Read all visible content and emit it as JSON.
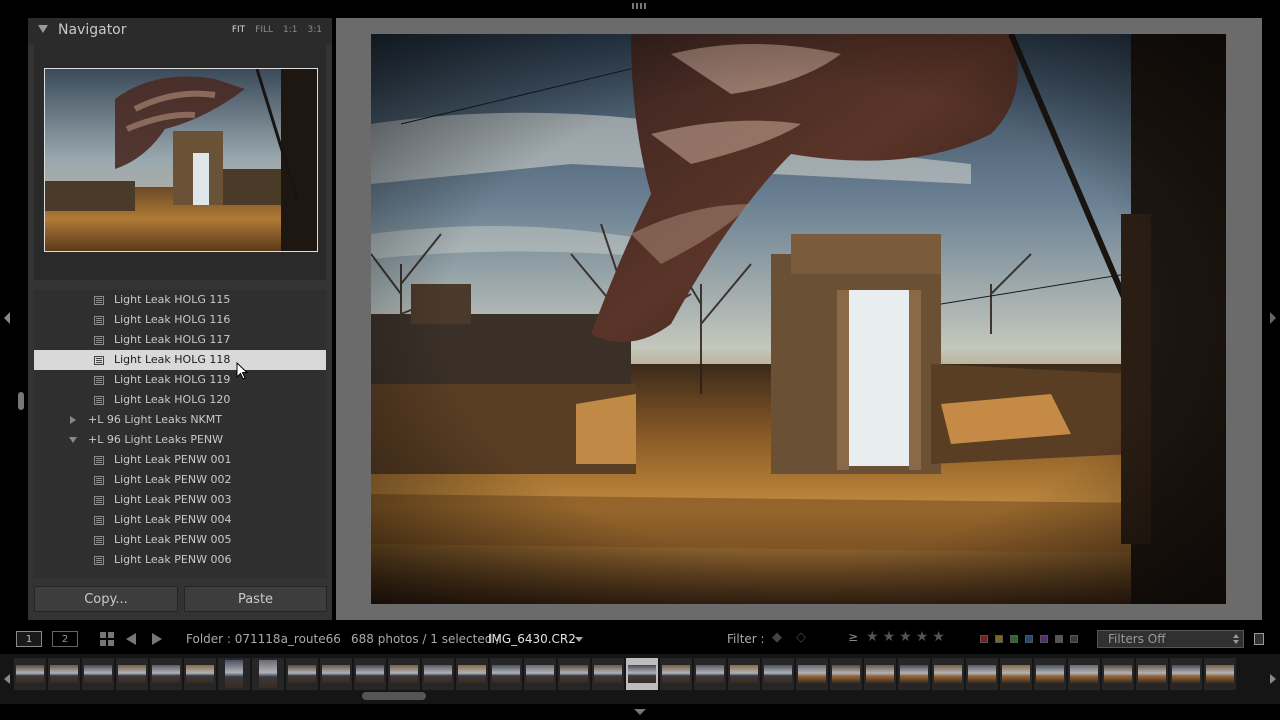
{
  "navigator": {
    "title": "Navigator",
    "zoom_options": [
      "FIT",
      "FILL",
      "1:1",
      "3:1"
    ],
    "active_zoom": "FIT"
  },
  "presets": {
    "rows": [
      {
        "type": "preset",
        "label": "Light Leak HOLG 115",
        "selected": false
      },
      {
        "type": "preset",
        "label": "Light Leak HOLG 116",
        "selected": false
      },
      {
        "type": "preset",
        "label": "Light Leak HOLG 117",
        "selected": false
      },
      {
        "type": "preset",
        "label": "Light Leak HOLG 118",
        "selected": true
      },
      {
        "type": "preset",
        "label": "Light Leak HOLG 119",
        "selected": false
      },
      {
        "type": "preset",
        "label": "Light Leak HOLG 120",
        "selected": false
      },
      {
        "type": "folder",
        "label": "+L 96 Light Leaks NKMT",
        "expanded": false
      },
      {
        "type": "folder",
        "label": "+L 96 Light Leaks PENW",
        "expanded": true
      },
      {
        "type": "preset",
        "label": "Light Leak PENW 001",
        "selected": false
      },
      {
        "type": "preset",
        "label": "Light Leak PENW 002",
        "selected": false
      },
      {
        "type": "preset",
        "label": "Light Leak PENW 003",
        "selected": false
      },
      {
        "type": "preset",
        "label": "Light Leak PENW 004",
        "selected": false
      },
      {
        "type": "preset",
        "label": "Light Leak PENW 005",
        "selected": false
      },
      {
        "type": "preset",
        "label": "Light Leak PENW 006",
        "selected": false
      }
    ]
  },
  "buttons": {
    "copy": "Copy...",
    "paste": "Paste"
  },
  "toolbar": {
    "view1": "1",
    "view2": "2",
    "folder": "Folder : 071118a_route66",
    "count": "688 photos / 1 selected /",
    "file": "IMG_6430.CR2",
    "filter_label": "Filter :",
    "rating_op": "≥",
    "stars": [
      "★",
      "★",
      "★",
      "★",
      "★"
    ],
    "filters_select": "Filters Off",
    "label_colors": [
      "#7a1f1f",
      "#7a6a1f",
      "#2a6a2a",
      "#1f4a7a",
      "#5a2a7a",
      "#555555",
      "#3a3a3a"
    ]
  },
  "filmstrip": {
    "thumb_count": 36,
    "selected_index": 18,
    "portrait_indices": [
      6,
      7
    ]
  },
  "colors": {
    "panel": "#333333",
    "main_bg": "#6b6b6b",
    "selected_row": "#d9d9d9"
  }
}
